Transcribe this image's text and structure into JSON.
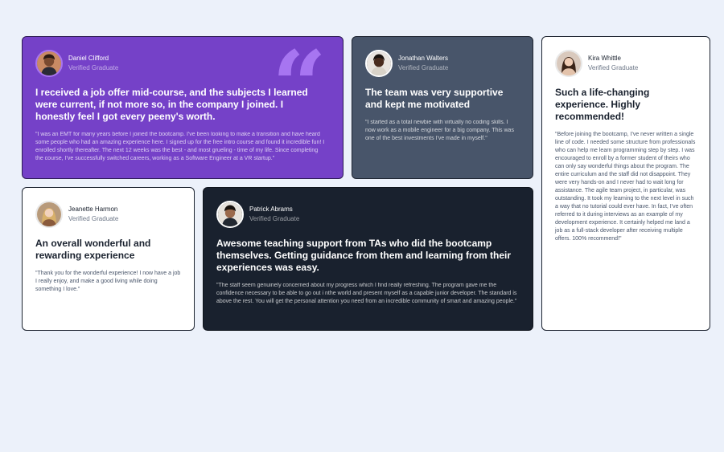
{
  "testimonials": [
    {
      "name": "Daniel Clifford",
      "role": "Verified Graduate",
      "headline": "I received a job offer mid-course, and the subjects I learned were current, if not more so, in the company I joined. I honestly feel I got every peeny's worth.",
      "quote": "\"I was an EMT for many years before I joined the bootcamp. I've been looking to make a transition and have heard some people who had an amazing experience here. I signed up for the free intro course and found it incredible fun! I enrolled shortly thereafter. The next 12 weeks was the best - and most grueling - time of my life. Since completing the course, I've successfully switched careers, working as a Software Engineer at a VR startup.\""
    },
    {
      "name": "Jonathan Walters",
      "role": "Verified Graduate",
      "headline": "The team was very supportive and kept me motivated",
      "quote": "\"I started as a total newbie with virtually no coding skills. I now work as a mobile engineer for a big company. This was one of the best investments I've made in myself.\""
    },
    {
      "name": "Kira Whittle",
      "role": "Verified Graduate",
      "headline": "Such a life-changing experience. Highly recommended!",
      "quote": "\"Before joining the bootcamp, I've never written a single line of code. I needed some structure from professionals who can help me learn programming step by step. I was encouraged to enroll by a former student of theirs who can only say wonderful things about the program. The entire curriculum and the staff did not disappoint. They were very hands-on and I never had to wait long for assistance. The agile team project, in particular, was outstanding. It took my learning to the next level in such a way that no tutorial could ever have. In fact, I've often referred to it during interviews as an example of my development experience. It certainly helped me land a job as a full-stack developer after receiving multiple offers. 100% recommend!\""
    },
    {
      "name": "Jeanette Harmon",
      "role": "Verified Graduate",
      "headline": "An overall wonderful and rewarding experience",
      "quote": "\"Thank you for the wonderful experience! I now have a job I really enjoy, and make a good living while doing something I love.\""
    },
    {
      "name": "Patrick Abrams",
      "role": "Verified Graduate",
      "headline": "Awesome teaching support from TAs who did the bootcamp themselves. Getting guidance from them and learning from their experiences was easy.",
      "quote": "\"The staff seem genuinely concerned about my progress which I find really refreshing. The program gave me the confidence necessary to be able to go out i nthe world and present myself as a capable junior developer. The standard is above the rest. You will get the personal attention you need from an incredible community of smart and amazing people.\""
    }
  ],
  "decor": {
    "quote_icon": "quotation-mark-icon",
    "quote_glyph": "“",
    "avatar_icon": "avatar-photo"
  },
  "colors": {
    "page_bg": "#ecf1fa",
    "violet": "#7541c8",
    "grayish_blue": "#48556a",
    "dark_blue": "#19212e",
    "white": "#ffffff",
    "light_violet": "#a775f1"
  }
}
